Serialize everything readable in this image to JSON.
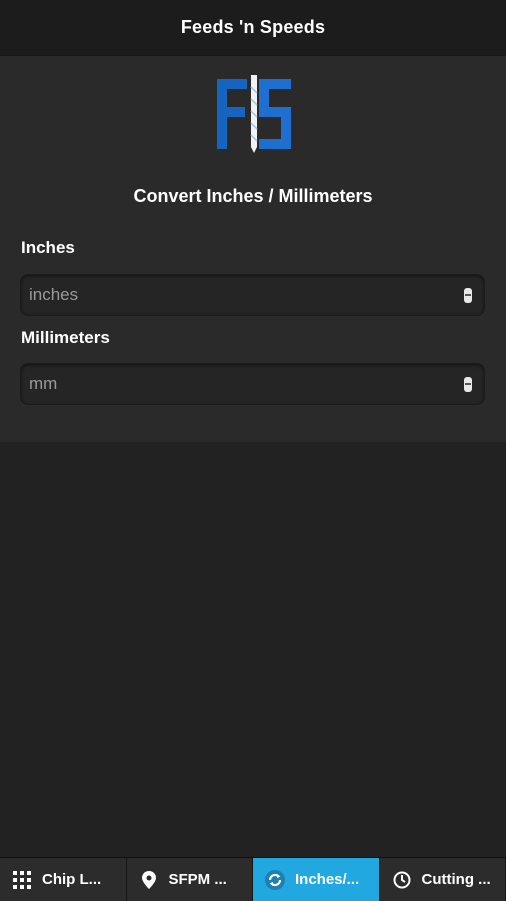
{
  "header": {
    "title": "Feeds 'n Speeds"
  },
  "logo": {
    "icon": "fs-logo-icon",
    "colors": {
      "blue": "#1565c0",
      "light": "#4a9be8"
    }
  },
  "main": {
    "subtitle": "Convert Inches / Millimeters",
    "fields": [
      {
        "label": "Inches",
        "placeholder": "inches",
        "value": ""
      },
      {
        "label": "Millimeters",
        "placeholder": "mm",
        "value": ""
      }
    ]
  },
  "tabs": [
    {
      "label": "Chip L...",
      "icon": "grid-icon",
      "active": false
    },
    {
      "label": "SFPM ...",
      "icon": "pin-icon",
      "active": false
    },
    {
      "label": "Inches/...",
      "icon": "sync-icon",
      "active": true
    },
    {
      "label": "Cutting ...",
      "icon": "clock-icon",
      "active": false
    }
  ],
  "colors": {
    "accent": "#22a8e0",
    "background": "#222222",
    "panel": "#2a2a2a"
  }
}
